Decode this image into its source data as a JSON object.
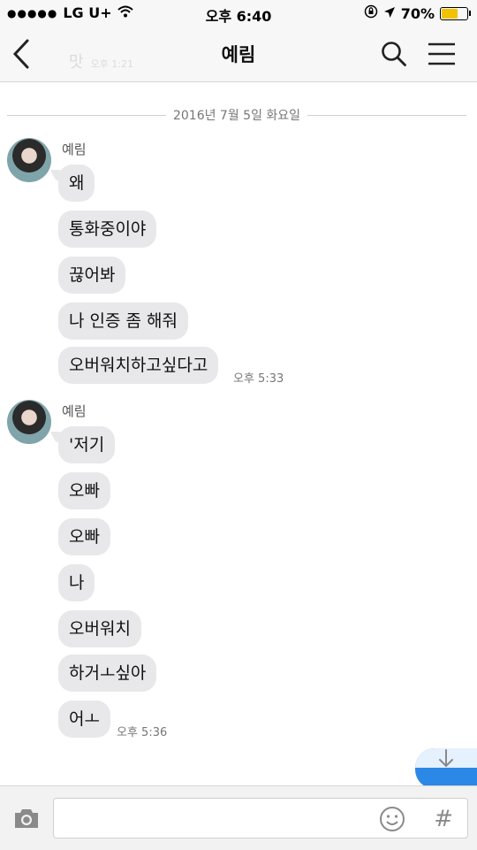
{
  "status_bar": {
    "carrier": "LG U+",
    "time": "오후 6:40",
    "battery_text": "70%",
    "battery_level": 0.7
  },
  "header": {
    "title": "예림",
    "ghost_text": "맛",
    "ghost_time": "오후 1:21"
  },
  "date_divider": "2016년 7월 5일 화요일",
  "groups": [
    {
      "sender": "예림",
      "messages": [
        "왜",
        "통화중이야",
        "끊어봐",
        "나 인증 좀 해줘",
        "오버워치하고싶다고"
      ],
      "time": "오후 5:33"
    },
    {
      "sender": "예림",
      "messages": [
        "'저기",
        "오빠",
        "오빠",
        "나",
        "오버워치",
        "하거ㅗ싶아",
        "어ㅗ"
      ],
      "time": "오후 5:36"
    }
  ],
  "composer": {
    "placeholder": "",
    "hash": "#"
  },
  "colors": {
    "bubble": "#e8e8ea",
    "accent": "#2c88e6"
  }
}
